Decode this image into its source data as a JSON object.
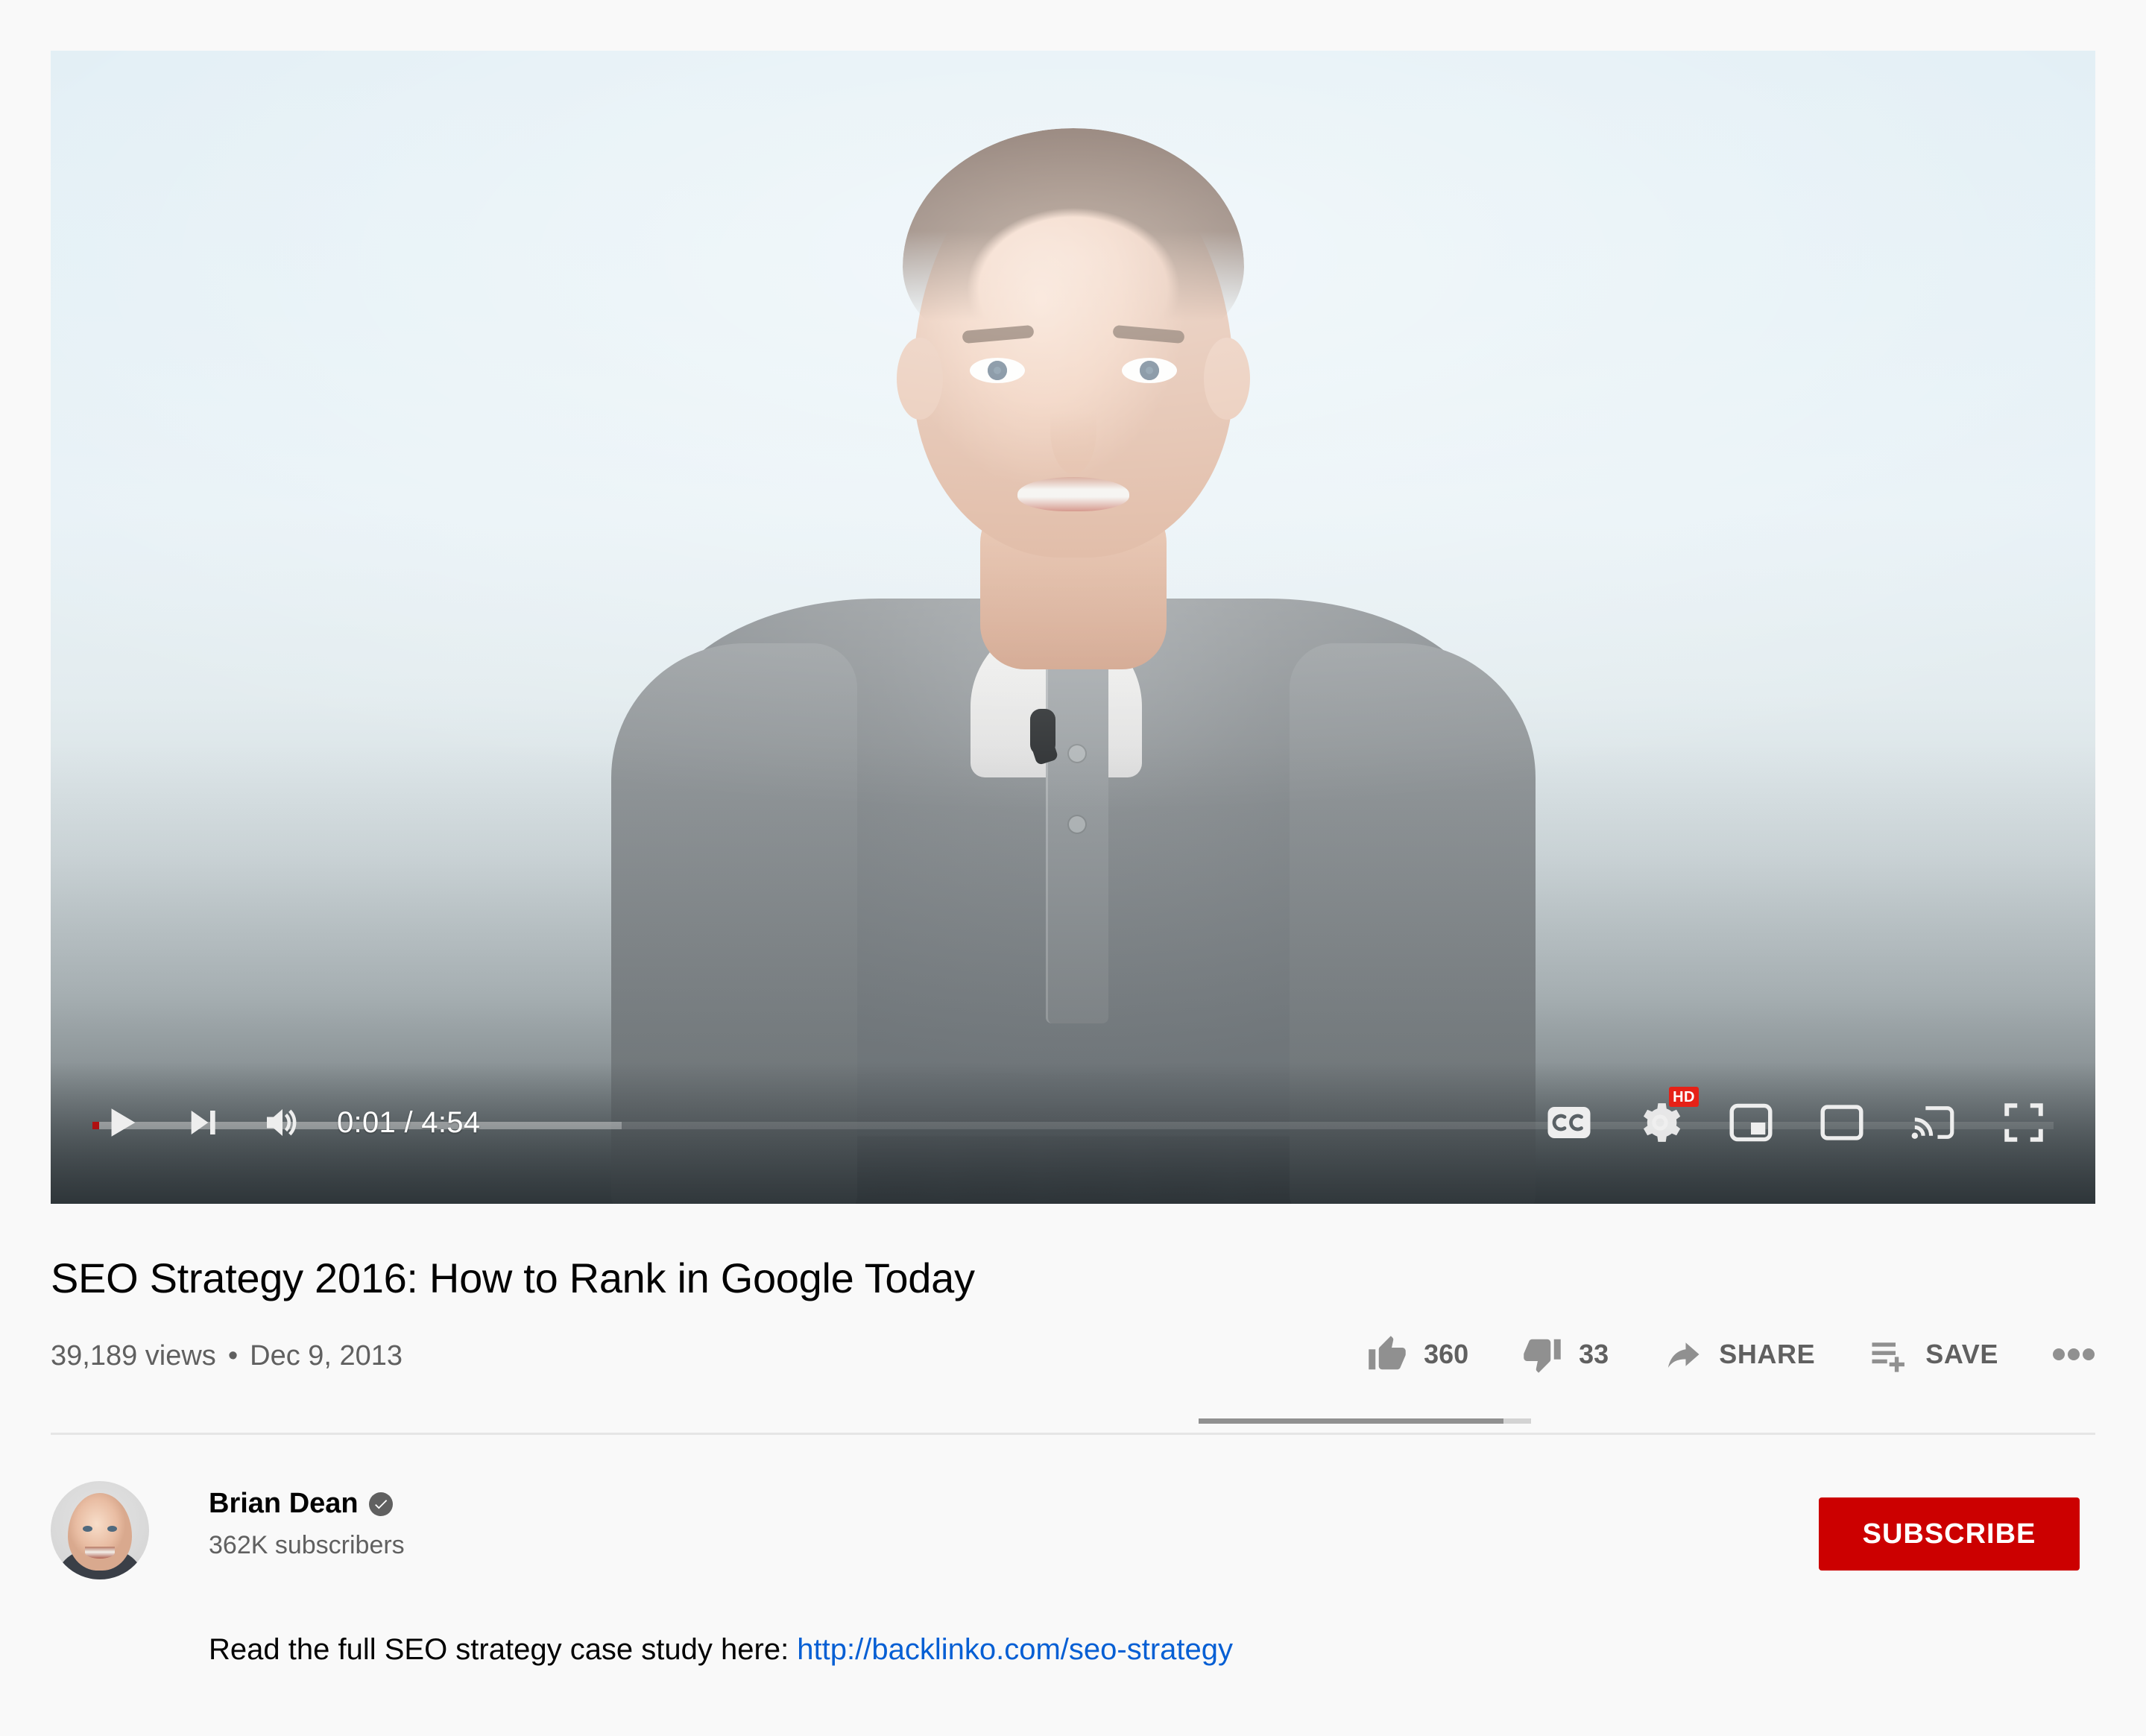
{
  "player": {
    "time_display": "0:01 / 4:54",
    "current_time": "0:01",
    "duration": "4:54",
    "progress_percent": 0.34,
    "buffered_percent": 27,
    "controls_left": [
      {
        "name": "play-button",
        "label": "Play"
      },
      {
        "name": "next-button",
        "label": "Next"
      },
      {
        "name": "volume-button",
        "label": "Mute"
      }
    ],
    "controls_right": [
      {
        "name": "captions-button",
        "label": "CC"
      },
      {
        "name": "settings-button",
        "label": "Settings",
        "badge": "HD"
      },
      {
        "name": "miniplayer-button",
        "label": "Miniplayer"
      },
      {
        "name": "theater-button",
        "label": "Theater mode"
      },
      {
        "name": "cast-button",
        "label": "Play on TV"
      },
      {
        "name": "fullscreen-button",
        "label": "Full screen"
      }
    ],
    "progress_color": "#ff0000"
  },
  "video": {
    "title": "SEO Strategy 2016: How to Rank in Google Today",
    "views": "39,189 views",
    "separator": "•",
    "date": "Dec 9, 2013"
  },
  "actions": {
    "like": {
      "label": "Like",
      "count": "360"
    },
    "dislike": {
      "label": "Dislike",
      "count": "33"
    },
    "share": {
      "label": "SHARE"
    },
    "save": {
      "label": "SAVE"
    },
    "more": {
      "label": "More actions"
    },
    "like_ratio_percent": 91.6
  },
  "channel": {
    "name": "Brian Dean",
    "verified": true,
    "subscribers": "362K subscribers",
    "subscribe_label": "SUBSCRIBE",
    "subscribe_color": "#cc0000"
  },
  "description": {
    "text": "Read the full SEO strategy case study here: ",
    "link_text": "http://backlinko.com/seo-strategy",
    "link_color": "#065fd4"
  }
}
